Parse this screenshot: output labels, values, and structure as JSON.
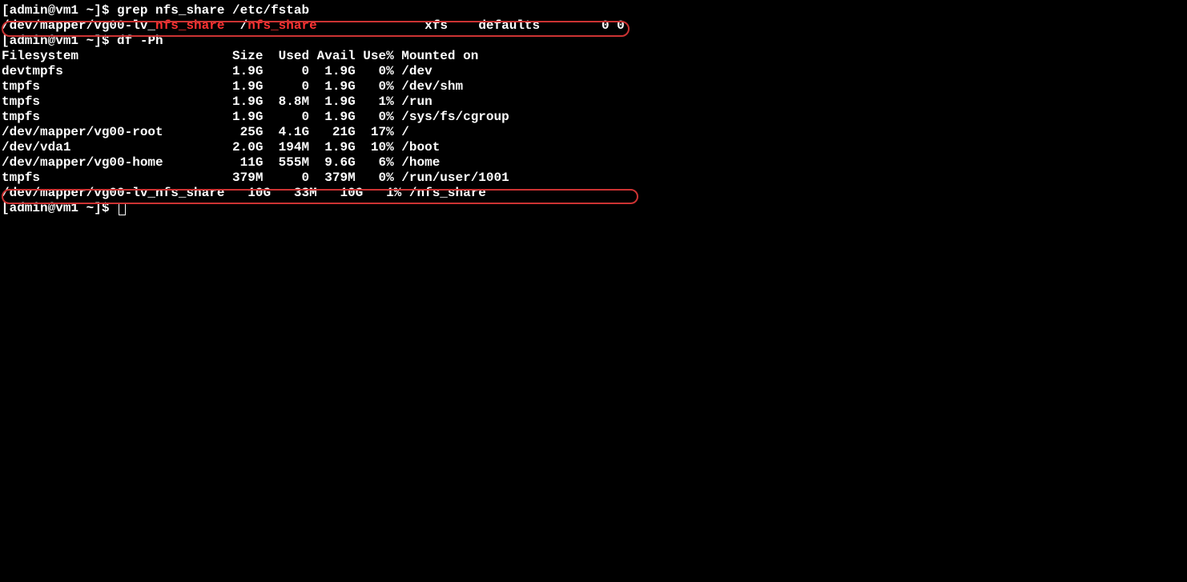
{
  "lines": {
    "prompt1": "[admin@vm1 ~]$ ",
    "cmd1": "grep nfs_share /etc/fstab",
    "grep_out_pre": "/dev/mapper/vg00-lv_",
    "grep_out_match1": "nfs_share",
    "grep_out_mid": "  /",
    "grep_out_match2": "nfs_share",
    "grep_out_post": "              xfs    defaults        0 0",
    "prompt2": "[admin@vm1 ~]$ ",
    "cmd2": "df -Ph",
    "df_header": "Filesystem                    Size  Used Avail Use% Mounted on",
    "df_rows": [
      "devtmpfs                      1.9G     0  1.9G   0% /dev",
      "tmpfs                         1.9G     0  1.9G   0% /dev/shm",
      "tmpfs                         1.9G  8.8M  1.9G   1% /run",
      "tmpfs                         1.9G     0  1.9G   0% /sys/fs/cgroup",
      "/dev/mapper/vg00-root          25G  4.1G   21G  17% /",
      "/dev/vda1                     2.0G  194M  1.9G  10% /boot",
      "/dev/mapper/vg00-home          11G  555M  9.6G   6% /home",
      "tmpfs                         379M     0  379M   0% /run/user/1001",
      "/dev/mapper/vg00-lv_nfs_share   10G   33M   10G   1% /nfs_share"
    ],
    "prompt3": "[admin@vm1 ~]$ "
  }
}
